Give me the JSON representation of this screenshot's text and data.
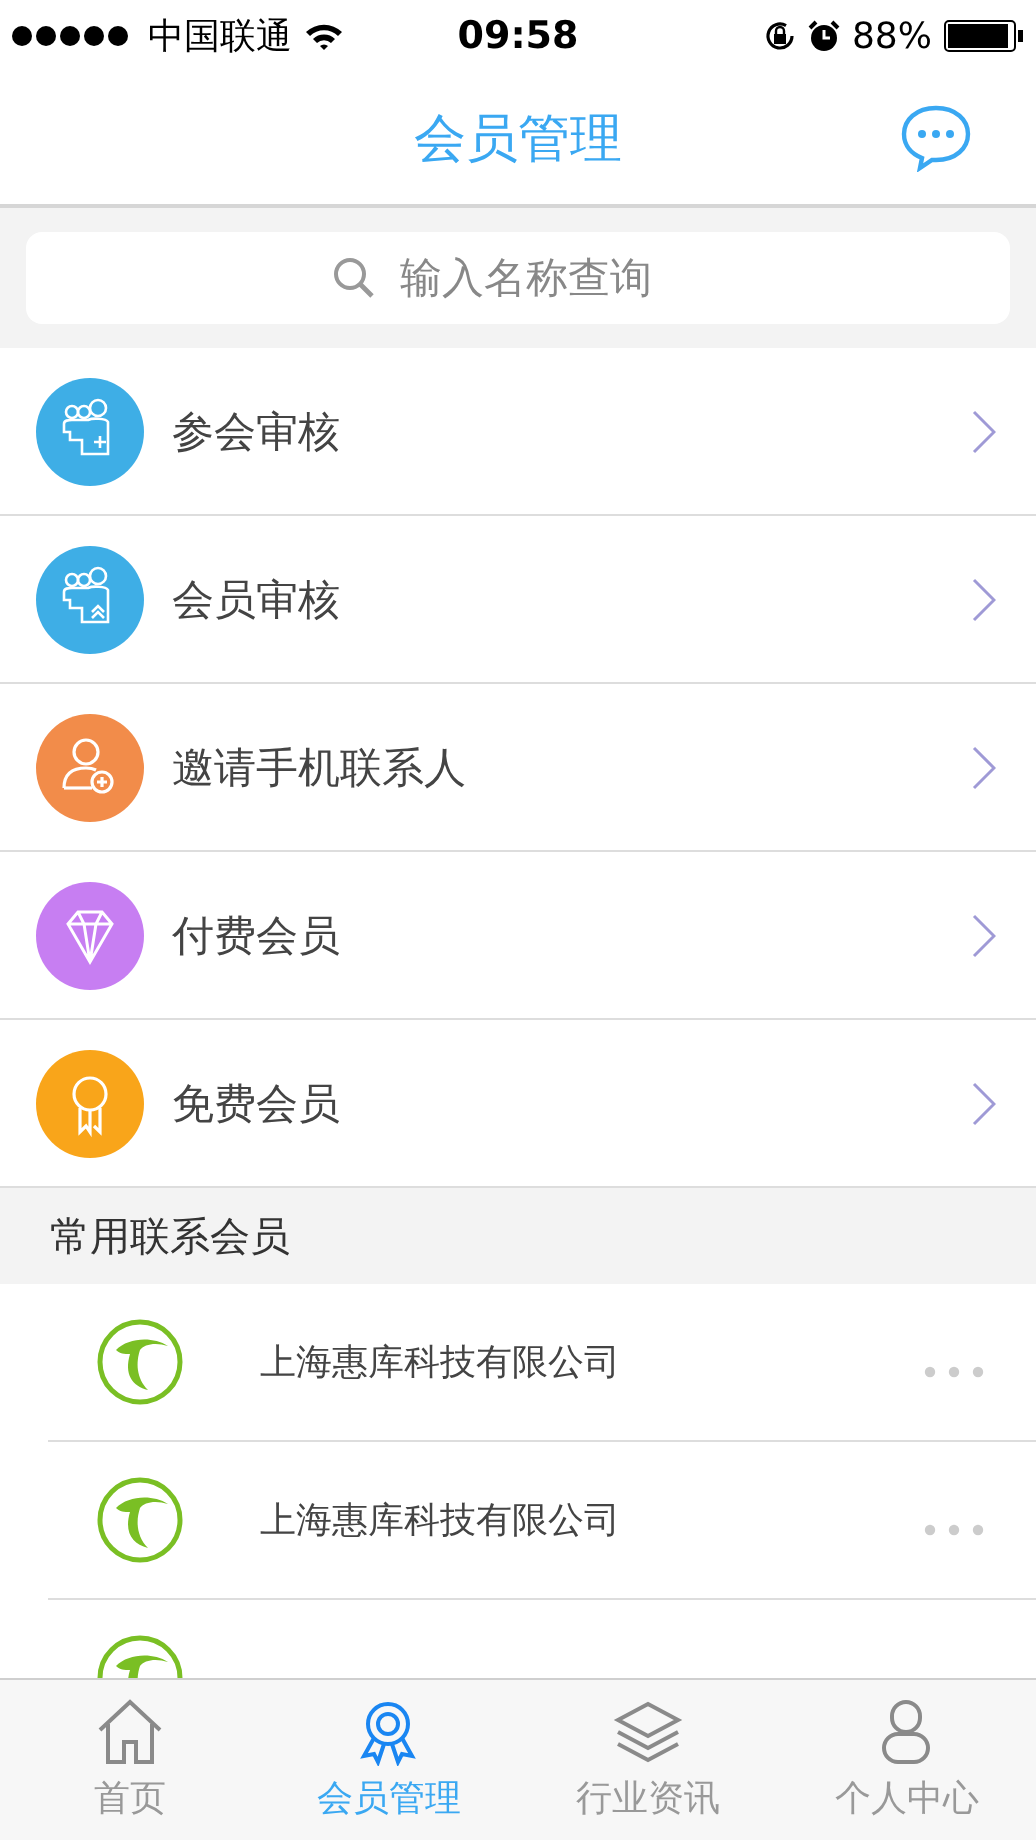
{
  "status_bar": {
    "carrier": "中国联通",
    "time": "09:58",
    "battery": "88%"
  },
  "header": {
    "title": "会员管理"
  },
  "search": {
    "placeholder": "输入名称查询"
  },
  "menu": [
    {
      "label": "参会审核",
      "kind": "group-add",
      "color": "#3eaee6"
    },
    {
      "label": "会员审核",
      "kind": "group-up",
      "color": "#3eaee6"
    },
    {
      "label": "邀请手机联系人",
      "kind": "person-add",
      "color": "#f28c4a"
    },
    {
      "label": "付费会员",
      "kind": "diamond",
      "color": "#c77ef2"
    },
    {
      "label": "免费会员",
      "kind": "award",
      "color": "#f9a51a"
    }
  ],
  "section": {
    "title": "常用联系会员"
  },
  "contacts": [
    {
      "kind": "company",
      "name": "上海惠库科技有限公司"
    },
    {
      "kind": "company",
      "name": "上海惠库科技有限公司"
    },
    {
      "kind": "cut"
    }
  ],
  "tabs": [
    {
      "label": "首页",
      "kind": "home",
      "selected": false
    },
    {
      "label": "会员管理",
      "kind": "award",
      "selected": true
    },
    {
      "label": "行业资讯",
      "kind": "layers",
      "selected": false
    },
    {
      "label": "个人中心",
      "kind": "person",
      "selected": false
    }
  ]
}
